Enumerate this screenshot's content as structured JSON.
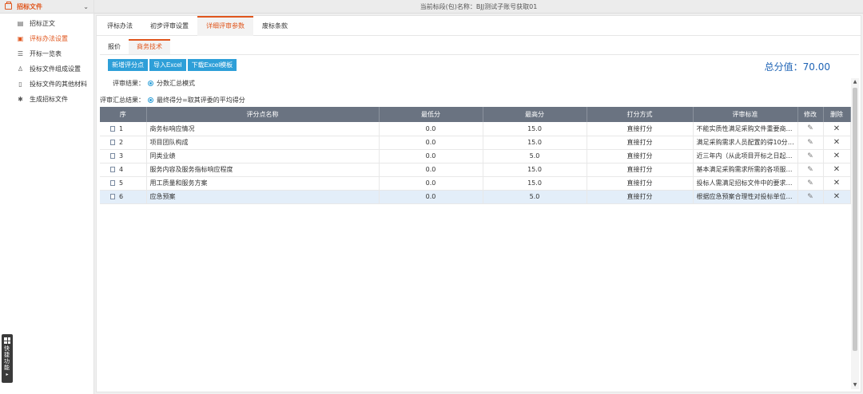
{
  "sidebar": {
    "title": "招标文件",
    "items": [
      {
        "label": "招标正文",
        "icon": "book-icon",
        "active": false
      },
      {
        "label": "评标办法设置",
        "icon": "calendar-icon",
        "active": true
      },
      {
        "label": "开标一览表",
        "icon": "list-icon",
        "active": false
      },
      {
        "label": "投标文件组成设置",
        "icon": "user-icon",
        "active": false
      },
      {
        "label": "投标文件的其他材料",
        "icon": "doc-icon",
        "active": false
      },
      {
        "label": "生成招标文件",
        "icon": "gear-icon",
        "active": false
      }
    ],
    "quick": "快捷功能"
  },
  "topbar": {
    "text": "当前标段(包)名称：BJJ测试子账号获取01"
  },
  "tabs": [
    "评标办法",
    "初步评审设置",
    "详细评审参数",
    "废标条款"
  ],
  "active_tab": 2,
  "subtabs": [
    "报价",
    "商务技术"
  ],
  "active_subtab": 1,
  "toolbar": {
    "add": "新增评分点",
    "import": "导入Excel",
    "download": "下载Excel模板"
  },
  "total": {
    "label": "总分值：",
    "value": "70.00"
  },
  "review_result": {
    "label": "评审结果：",
    "option": "分数汇总模式"
  },
  "summary_result": {
    "label": "评审汇总结果：",
    "option": "最终得分=取其评委的平均得分"
  },
  "table": {
    "headers": [
      "序",
      "评分点名称",
      "最低分",
      "最高分",
      "打分方式",
      "评审标准",
      "修改",
      "删除"
    ],
    "rows": [
      {
        "seq": "1",
        "name": "商务标响应情况",
        "min": "0.0",
        "max": "15.0",
        "method": "直接打分",
        "criteria": "不能实质性满足采购文件重要商务条…"
      },
      {
        "seq": "2",
        "name": "项目团队构成",
        "min": "0.0",
        "max": "15.0",
        "method": "直接打分",
        "criteria": "满足采购需求人员配置的得10分、…"
      },
      {
        "seq": "3",
        "name": "同类业绩",
        "min": "0.0",
        "max": "5.0",
        "method": "直接打分",
        "criteria": "近三年内（从此项目开标之日起前三…"
      },
      {
        "seq": "4",
        "name": "服务内容及服务指标响应程度",
        "min": "0.0",
        "max": "15.0",
        "method": "直接打分",
        "criteria": "基本满足采购需求所需的各项服务内…"
      },
      {
        "seq": "5",
        "name": "用工质量和服务方案",
        "min": "0.0",
        "max": "15.0",
        "method": "直接打分",
        "criteria": "投标人需满足招标文件中的要求得1…"
      },
      {
        "seq": "6",
        "name": "应急预案",
        "min": "0.0",
        "max": "5.0",
        "method": "直接打分",
        "criteria": "根据应急预案合理性对投标单位进行…"
      }
    ],
    "selected_row": 5
  },
  "colors": {
    "accent": "#e0561d",
    "button": "#2e9fd8",
    "header": "#6a7381",
    "total": "#1e63b5"
  }
}
